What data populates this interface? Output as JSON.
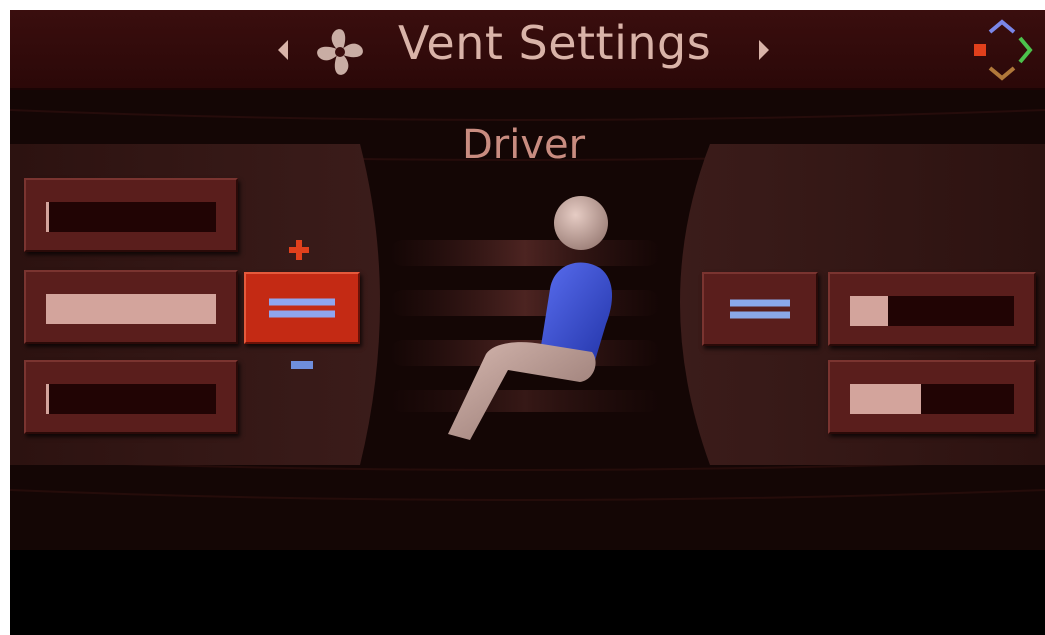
{
  "header": {
    "title": "Vent Settings",
    "icons": [
      "chevron-left-icon",
      "fan-icon",
      "chevron-right-icon",
      "nav-compass-icon"
    ]
  },
  "zone": {
    "label": "Driver"
  },
  "left_vents": [
    {
      "level_fraction": 0.02
    },
    {
      "level_fraction": 1.0
    },
    {
      "level_fraction": 0.02
    }
  ],
  "left_toggle": {
    "selected": true,
    "icon": "equals-icon",
    "increase_icon": "plus-icon",
    "decrease_icon": "minus-icon"
  },
  "right_toggle": {
    "selected": false,
    "icon": "equals-icon"
  },
  "right_vents": [
    {
      "level_fraction": 0.23
    },
    {
      "level_fraction": 0.43
    }
  ],
  "colors": {
    "header_bg": "#3a0e0e",
    "title_text": "#d9b3a8",
    "driver_text": "#c98c80",
    "active_button": "#c42a14",
    "vent_lines": "#8aa8ea",
    "bar_fill": "#d3a49c",
    "seat_body": "#3a4fd0",
    "seat_skin": "#c9a79f"
  }
}
